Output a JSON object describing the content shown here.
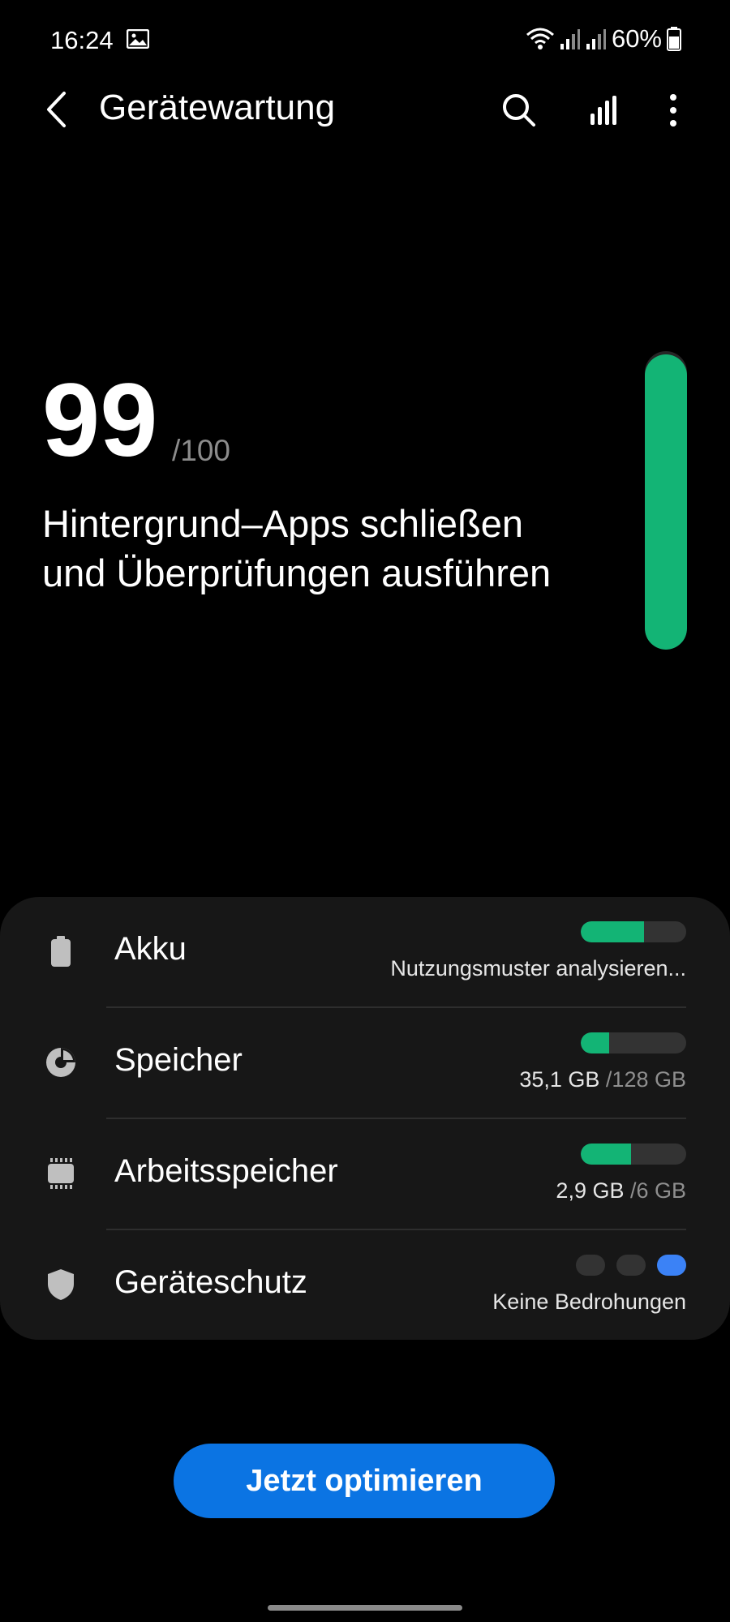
{
  "status_bar": {
    "time": "16:24",
    "battery_percent": "60%",
    "icons": [
      "gallery-icon",
      "wifi-icon",
      "signal-icon",
      "signal-icon",
      "battery-icon"
    ]
  },
  "app_bar": {
    "title": "Gerätewartung",
    "icons": [
      "back-icon",
      "search-icon",
      "stats-icon",
      "more-icon"
    ]
  },
  "score": {
    "value": "99",
    "max_label": "/100",
    "message": "Hintergrund–Apps schließen und Überprüfungen ausführen",
    "gauge_fraction": 0.99
  },
  "items": [
    {
      "name": "battery",
      "label": "Akku",
      "status": "Nutzungsmuster analysieren...",
      "fill_fraction": 0.6,
      "icon": "battery-icon"
    },
    {
      "name": "storage",
      "label": "Speicher",
      "used": "35,1 GB",
      "total": " /128 GB",
      "fill_fraction": 0.27,
      "icon": "pie-chart-icon"
    },
    {
      "name": "memory",
      "label": "Arbeitsspeicher",
      "used": "2,9 GB",
      "total": " /6 GB",
      "fill_fraction": 0.48,
      "icon": "memory-chip-icon"
    },
    {
      "name": "protection",
      "label": "Geräteschutz",
      "status": "Keine Bedrohungen",
      "active_dot": 3,
      "icon": "shield-icon"
    }
  ],
  "actions": {
    "optimize_label": "Jetzt optimieren"
  },
  "colors": {
    "accent_green": "#13b475",
    "accent_blue": "#0b74e3",
    "card_bg": "#171717",
    "dot_blue": "#3b82f6"
  }
}
